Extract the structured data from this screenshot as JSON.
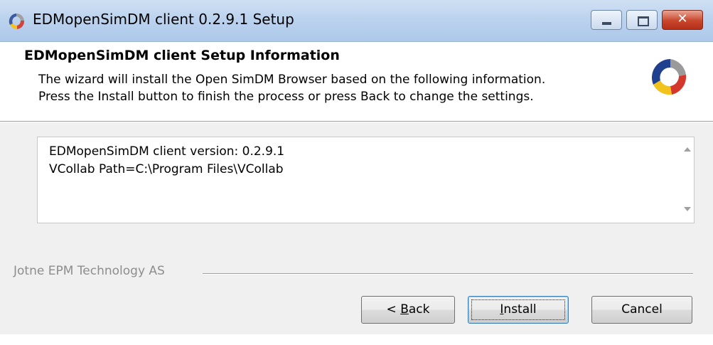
{
  "window": {
    "title": "EDMopenSimDM client 0.2.9.1 Setup",
    "icon": "installer-logo-icon",
    "controls": {
      "minimize": "minimize-icon",
      "maximize": "maximize-icon",
      "close": "close-icon"
    }
  },
  "header": {
    "title": "EDMopenSimDM client Setup Information",
    "description_line1": "The wizard will install the Open SimDM Browser based on the following information.",
    "description_line2": "Press the Install button to finish the process or press Back to change the settings.",
    "logo": "installer-logo-icon"
  },
  "info": {
    "lines": [
      "EDMopenSimDM client version: 0.2.9.1",
      "VCollab Path=C:\\Program Files\\VCollab"
    ]
  },
  "branding": {
    "text": "Jotne EPM Technology AS"
  },
  "buttons": {
    "back_prefix": "< ",
    "back_mnemonic": "B",
    "back_rest": "ack",
    "install_mnemonic": "I",
    "install_rest": "nstall",
    "cancel": "Cancel"
  },
  "colors": {
    "titlebar": "#bcd3ee",
    "close_button": "#c9452c",
    "header_bg": "#ffffff",
    "dialog_bg": "#f0f0f0"
  }
}
